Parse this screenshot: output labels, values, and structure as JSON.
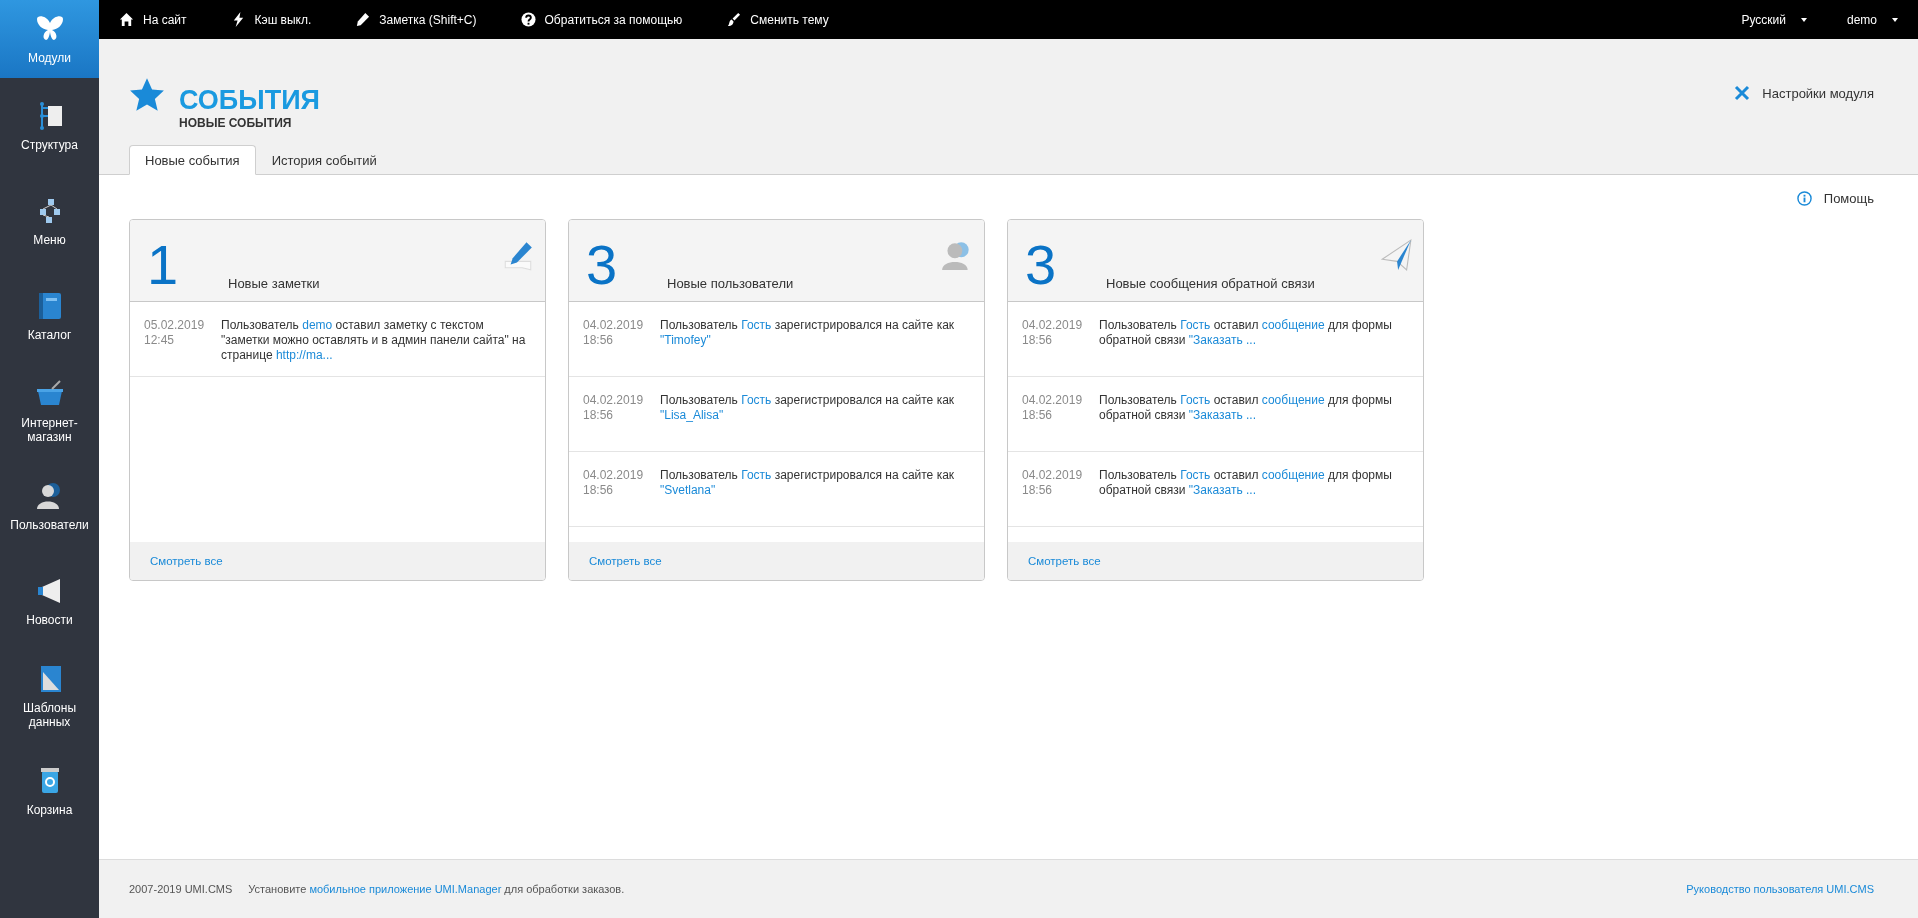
{
  "sidebar": {
    "items": [
      {
        "label": "Модули",
        "selected": true
      },
      {
        "label": "Структура",
        "selected": false
      },
      {
        "label": "Меню",
        "selected": false
      },
      {
        "label": "Каталог",
        "selected": false
      },
      {
        "label": "Интернет-магазин",
        "selected": false
      },
      {
        "label": "Пользователи",
        "selected": false
      },
      {
        "label": "Новости",
        "selected": false
      },
      {
        "label": "Шаблоны данных",
        "selected": false
      },
      {
        "label": "Корзина",
        "selected": false
      }
    ]
  },
  "top_bar": {
    "items": [
      {
        "label": "На сайт"
      },
      {
        "label": "Кэш выкл."
      },
      {
        "label": "Заметка (Shift+C)"
      },
      {
        "label": "Обратиться за помощью"
      },
      {
        "label": "Сменить тему"
      }
    ],
    "language": "Русский",
    "user": "demo"
  },
  "header": {
    "title": "СОБЫТИЯ",
    "subtitle": "НОВЫЕ СОБЫТИЯ",
    "settings_link": "Настройки модуля"
  },
  "tabs": [
    {
      "label": "Новые события",
      "selected": true
    },
    {
      "label": "История событий",
      "selected": false
    }
  ],
  "help_link": "Помощь",
  "cards": [
    {
      "count": "1",
      "title": "Новые заметки",
      "footer_link": "Смотреть все",
      "events": [
        {
          "date": "05.02.2019",
          "time": "12:45",
          "parts": [
            {
              "text": "Пользователь ",
              "link": false
            },
            {
              "text": "demo",
              "link": true
            },
            {
              "text": " оставил заметку с текстом \"заметки можно оставлять и в админ панели сайта\" на странице ",
              "link": false
            },
            {
              "text": "http://ma...",
              "link": true
            }
          ]
        }
      ]
    },
    {
      "count": "3",
      "title": "Новые пользователи",
      "footer_link": "Смотреть все",
      "events": [
        {
          "date": "04.02.2019",
          "time": "18:56",
          "parts": [
            {
              "text": "Пользователь ",
              "link": false
            },
            {
              "text": "Гость",
              "link": true
            },
            {
              "text": " зарегистрировался на сайте как ",
              "link": false
            },
            {
              "text": "\"Timofey\"",
              "link": true
            }
          ]
        },
        {
          "date": "04.02.2019",
          "time": "18:56",
          "parts": [
            {
              "text": "Пользователь ",
              "link": false
            },
            {
              "text": "Гость",
              "link": true
            },
            {
              "text": " зарегистрировался на сайте как ",
              "link": false
            },
            {
              "text": "\"Lisa_Alisa\"",
              "link": true
            }
          ]
        },
        {
          "date": "04.02.2019",
          "time": "18:56",
          "parts": [
            {
              "text": "Пользователь ",
              "link": false
            },
            {
              "text": "Гость",
              "link": true
            },
            {
              "text": " зарегистрировался на сайте как ",
              "link": false
            },
            {
              "text": "\"Svetlana\"",
              "link": true
            }
          ]
        }
      ]
    },
    {
      "count": "3",
      "title": "Новые сообщения обратной связи",
      "footer_link": "Смотреть все",
      "events": [
        {
          "date": "04.02.2019",
          "time": "18:56",
          "parts": [
            {
              "text": "Пользователь ",
              "link": false
            },
            {
              "text": "Гость",
              "link": true
            },
            {
              "text": " оставил ",
              "link": false
            },
            {
              "text": "сообщение",
              "link": true
            },
            {
              "text": " для формы обратной связи ",
              "link": false
            },
            {
              "text": "\"Заказать ...",
              "link": true
            }
          ]
        },
        {
          "date": "04.02.2019",
          "time": "18:56",
          "parts": [
            {
              "text": "Пользователь ",
              "link": false
            },
            {
              "text": "Гость",
              "link": true
            },
            {
              "text": " оставил ",
              "link": false
            },
            {
              "text": "сообщение",
              "link": true
            },
            {
              "text": " для формы обратной связи ",
              "link": false
            },
            {
              "text": "\"Заказать ...",
              "link": true
            }
          ]
        },
        {
          "date": "04.02.2019",
          "time": "18:56",
          "parts": [
            {
              "text": "Пользователь ",
              "link": false
            },
            {
              "text": "Гость",
              "link": true
            },
            {
              "text": " оставил ",
              "link": false
            },
            {
              "text": "сообщение",
              "link": true
            },
            {
              "text": " для формы обратной связи ",
              "link": false
            },
            {
              "text": "\"Заказать ...",
              "link": true
            }
          ]
        }
      ]
    }
  ],
  "footer": {
    "copyright": "2007-2019 UMI.CMS",
    "promo": [
      {
        "text": "Установите ",
        "link": false
      },
      {
        "text": "мобильное приложение UMI.Manager",
        "link": true
      },
      {
        "text": " для обработки заказов.",
        "link": false
      }
    ],
    "manual_link": "Руководство пользователя UMI.CMS"
  }
}
